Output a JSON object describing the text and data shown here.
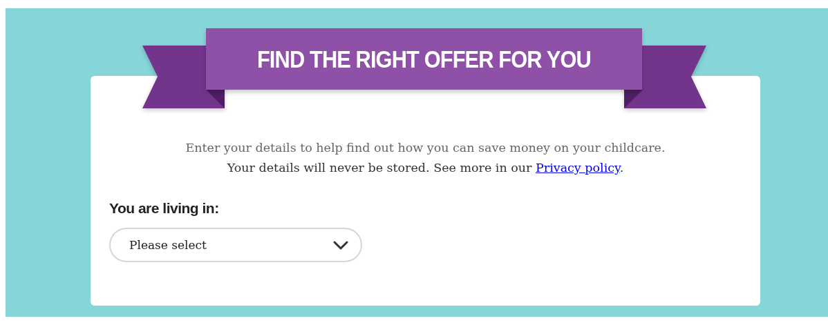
{
  "banner": {
    "title": "FIND THE RIGHT OFFER FOR YOU"
  },
  "intro": {
    "text": "Enter your details to help find out how you can save money on your childcare.",
    "notice": "Your details will never be stored. See more in our ",
    "link": "Privacy policy",
    "notice_end": "."
  },
  "field": {
    "label": "You are living in:",
    "placeholder": "Please select"
  }
}
